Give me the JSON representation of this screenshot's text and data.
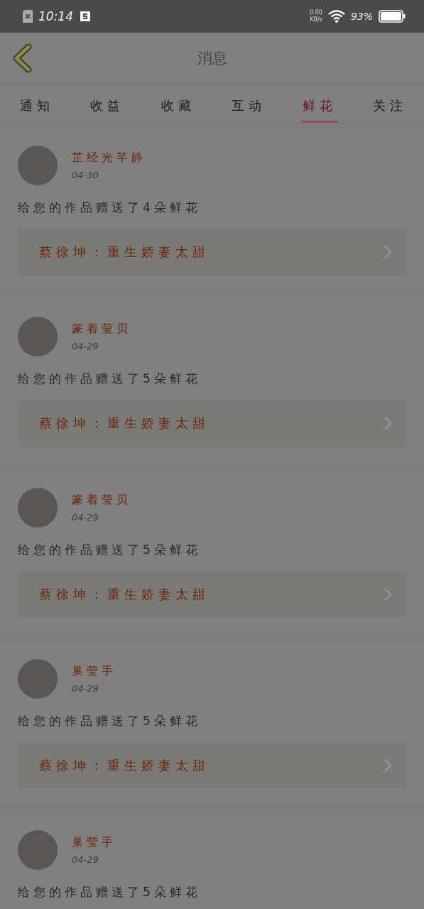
{
  "status_bar": {
    "time": "10:14",
    "net_speed": "0.00",
    "net_unit": "KB/s",
    "battery": "93%"
  },
  "header": {
    "title": "消息"
  },
  "tabs": [
    {
      "label": "通知",
      "selected": false
    },
    {
      "label": "收益",
      "selected": false
    },
    {
      "label": "收藏",
      "selected": false
    },
    {
      "label": "互动",
      "selected": false
    },
    {
      "label": "鲜花",
      "selected": true
    },
    {
      "label": "关注",
      "selected": false
    }
  ],
  "messages": [
    {
      "user": "芷经光芊静",
      "date": "04-30",
      "text": "给您的作品赠送了4朵鲜花",
      "book": "蔡徐坤：重生娇妻太甜"
    },
    {
      "user": "篆着莹贝",
      "date": "04-29",
      "text": "给您的作品赠送了5朵鲜花",
      "book": "蔡徐坤：重生娇妻太甜"
    },
    {
      "user": "篆着莹贝",
      "date": "04-29",
      "text": "给您的作品赠送了5朵鲜花",
      "book": "蔡徐坤：重生娇妻太甜"
    },
    {
      "user": "巢莹手",
      "date": "04-29",
      "text": "给您的作品赠送了5朵鲜花",
      "book": "蔡徐坤：重生娇妻太甜"
    },
    {
      "user": "巢莹手",
      "date": "04-29",
      "text": "给您的作品赠送了5朵鲜花"
    }
  ]
}
